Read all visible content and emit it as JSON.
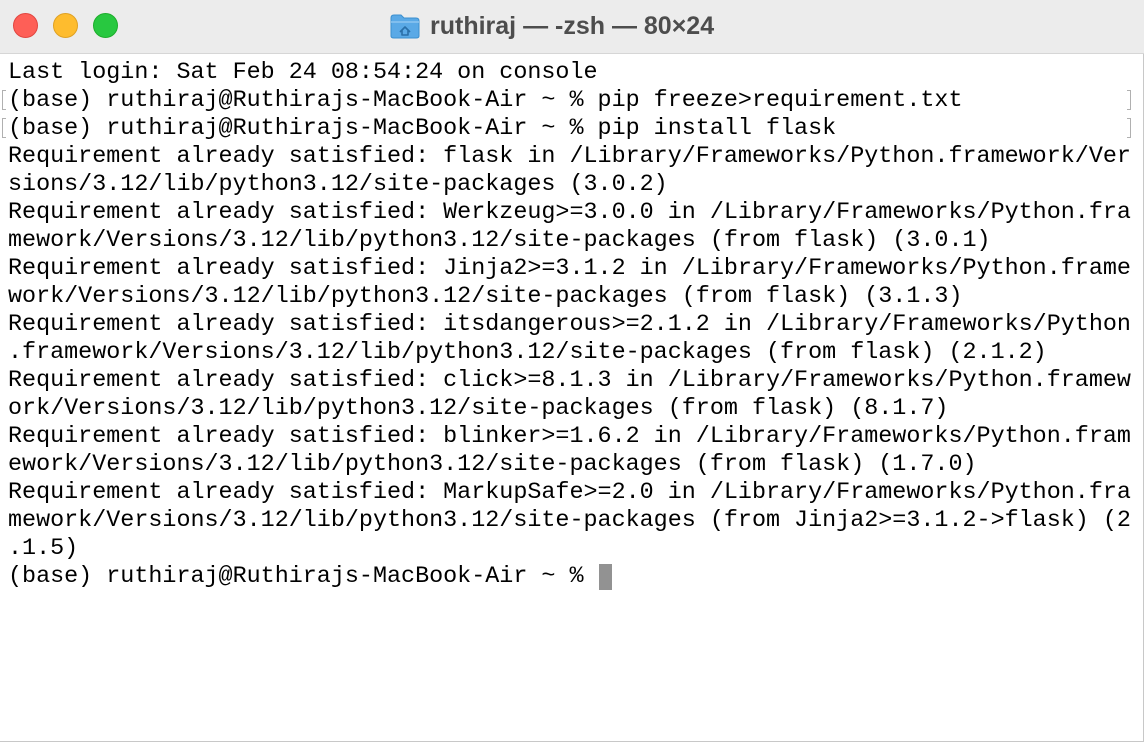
{
  "window": {
    "title": "ruthiraj — -zsh — 80×24",
    "title_icon": "folder-home-icon"
  },
  "terminal": {
    "lines": [
      "Last login: Sat Feb 24 08:54:24 on console",
      "(base) ruthiraj@Ruthirajs-MacBook-Air ~ % pip freeze>requirement.txt",
      "(base) ruthiraj@Ruthirajs-MacBook-Air ~ % pip install flask",
      "Requirement already satisfied: flask in /Library/Frameworks/Python.framework/Ver",
      "sions/3.12/lib/python3.12/site-packages (3.0.2)",
      "Requirement already satisfied: Werkzeug>=3.0.0 in /Library/Frameworks/Python.fra",
      "mework/Versions/3.12/lib/python3.12/site-packages (from flask) (3.0.1)",
      "Requirement already satisfied: Jinja2>=3.1.2 in /Library/Frameworks/Python.frame",
      "work/Versions/3.12/lib/python3.12/site-packages (from flask) (3.1.3)",
      "Requirement already satisfied: itsdangerous>=2.1.2 in /Library/Frameworks/Python",
      ".framework/Versions/3.12/lib/python3.12/site-packages (from flask) (2.1.2)",
      "Requirement already satisfied: click>=8.1.3 in /Library/Frameworks/Python.framew",
      "ork/Versions/3.12/lib/python3.12/site-packages (from flask) (8.1.7)",
      "Requirement already satisfied: blinker>=1.6.2 in /Library/Frameworks/Python.fram",
      "ework/Versions/3.12/lib/python3.12/site-packages (from flask) (1.7.0)",
      "Requirement already satisfied: MarkupSafe>=2.0 in /Library/Frameworks/Python.fra",
      "mework/Versions/3.12/lib/python3.12/site-packages (from Jinja2>=3.1.2->flask) (2",
      ".1.5)"
    ],
    "prompt": "(base) ruthiraj@Ruthirajs-MacBook-Air ~ % "
  },
  "colors": {
    "close": "#fe5f57",
    "minimize": "#febc2e",
    "zoom": "#28c840",
    "cursor": "#929292",
    "folder": "#5aa9e6"
  }
}
